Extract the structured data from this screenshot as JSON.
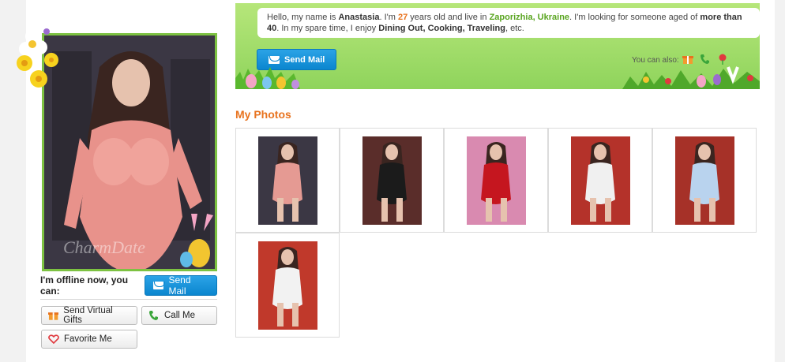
{
  "bio": {
    "t1": "Hello, my name is ",
    "name": "Anastasia",
    "t2": ". I'm ",
    "age": "27",
    "t3": " years old and live in ",
    "location": "Zaporizhia, Ukraine",
    "t4": ". I'm looking for someone aged of ",
    "seeking": "more than 40",
    "t5": ". In my spare time, I enjoy ",
    "interests": "Dining Out, Cooking, Traveling",
    "t6": ", etc."
  },
  "banner": {
    "send_mail_label": "Send Mail",
    "you_can_also": "You can also:",
    "also_icons": [
      "gift-icon",
      "phone-icon",
      "rose-icon"
    ]
  },
  "profile": {
    "watermark": "CharmDate",
    "offline_text": "I'm offline now, you can:",
    "send_mail_label": "Send Mail",
    "send_gifts_label": "Send Virtual Gifts",
    "call_me_label": "Call Me",
    "favorite_label": "Favorite Me"
  },
  "photos": {
    "title": "My Photos",
    "items": [
      {
        "bg": "#3b3744",
        "dress": "#e59a93"
      },
      {
        "bg": "#5a2d2a",
        "dress": "#1b1b1b"
      },
      {
        "bg": "#d98ab0",
        "dress": "#c5161f"
      },
      {
        "bg": "#b4322a",
        "dress": "#f0f0f0"
      },
      {
        "bg": "#a63128",
        "dress": "#b9d3ee"
      },
      {
        "bg": "#c0392b",
        "dress": "#f2f2f2"
      }
    ]
  },
  "colors": {
    "accent_orange": "#e8731f",
    "accent_green": "#5aa521",
    "button_blue": "#0b86cf",
    "frame_green": "#7dc242"
  }
}
